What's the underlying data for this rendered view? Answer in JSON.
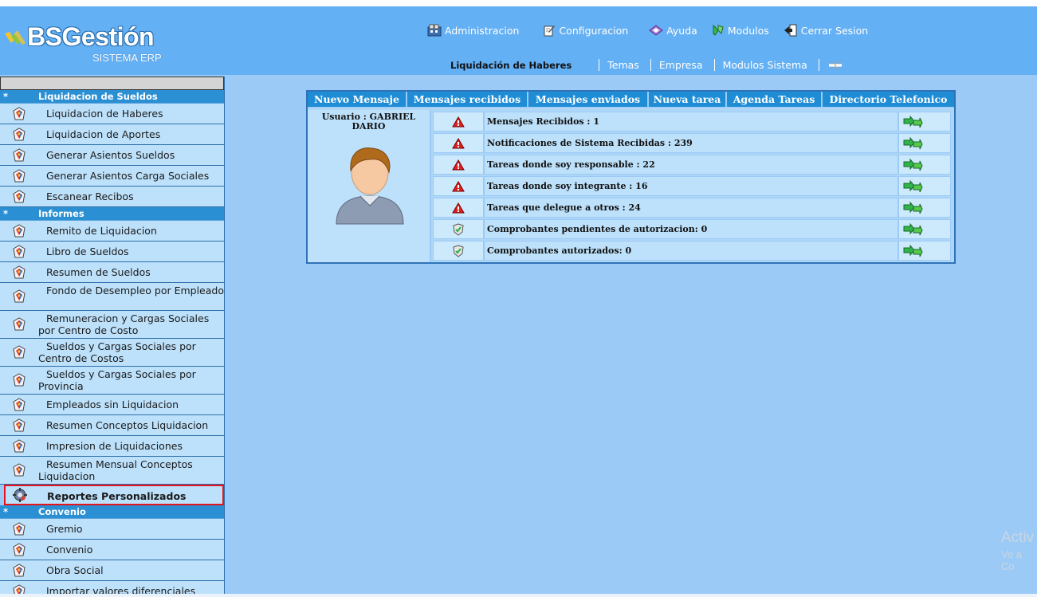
{
  "logo": {
    "brand": "BSGestión",
    "subtitle": "SISTEMA ERP"
  },
  "topnav": [
    {
      "label": "Administracion",
      "icon": "admin-icon"
    },
    {
      "label": "Configuracion",
      "icon": "config-icon"
    },
    {
      "label": "Ayuda",
      "icon": "help-icon"
    },
    {
      "label": "Modulos",
      "icon": "modules-icon"
    },
    {
      "label": "Cerrar Sesion",
      "icon": "logout-icon"
    }
  ],
  "subnav": {
    "current": "Liquidación de Haberes",
    "links": [
      "Temas",
      "Empresa",
      "Modulos Sistema"
    ],
    "flag_icon": "argentina-flag-icon"
  },
  "sidebar": {
    "sections": [
      {
        "star": "*",
        "title": "Liquidacion de Sueldos",
        "items": [
          "Liquidacion de Haberes",
          "Liquidacion de Aportes",
          "Generar Asientos Sueldos",
          "Generar Asientos Carga Sociales",
          "Escanear Recibos"
        ]
      },
      {
        "star": "*",
        "title": "Informes",
        "items": [
          "Remito de Liquidacion",
          "Libro de Sueldos",
          "Resumen de Sueldos",
          "Fondo de Desempleo por Empleado",
          "Remuneracion y Cargas Sociales por Centro de Costo",
          "Sueldos y Cargas Sociales por Centro de Costos",
          "Sueldos y Cargas Sociales por Provincia",
          "Empleados sin Liquidacion",
          "Resumen Conceptos Liquidacion",
          "Impresion de Liquidaciones",
          "Resumen Mensual Conceptos Liquidacion",
          "Reportes Personalizados"
        ]
      },
      {
        "star": "*",
        "title": "Convenio",
        "items": [
          "Gremio",
          "Convenio",
          "Obra Social",
          "Importar valores diferenciales"
        ]
      }
    ],
    "selected_item": "Reportes Personalizados"
  },
  "panel": {
    "tabs": [
      "Nuevo Mensaje",
      "Mensajes recibidos",
      "Mensajes enviados",
      "Nueva tarea",
      "Agenda Tareas",
      "Directorio Telefonico"
    ],
    "user_label": "Usuario : GABRIEL DARIO",
    "rows": [
      {
        "status": "warning",
        "text": "Mensajes Recibidos : 1"
      },
      {
        "status": "warning",
        "text": "Notificaciones de Sistema Recibidas : 239"
      },
      {
        "status": "warning",
        "text": "Tareas donde soy responsable : 22"
      },
      {
        "status": "warning",
        "text": "Tareas donde soy integrante : 16"
      },
      {
        "status": "warning",
        "text": "Tareas que delegue a otros : 24"
      },
      {
        "status": "ok",
        "text": "Comprobantes pendientes de autorizacion: 0"
      },
      {
        "status": "ok",
        "text": "Comprobantes autorizados: 0"
      }
    ]
  },
  "watermark": {
    "line1": "Activ",
    "line2": "Ve a Co"
  },
  "colors": {
    "header": "#64b0f4",
    "background": "#9ccaf6",
    "section": "#2b8fd3",
    "selected_border": "#e8141c"
  }
}
